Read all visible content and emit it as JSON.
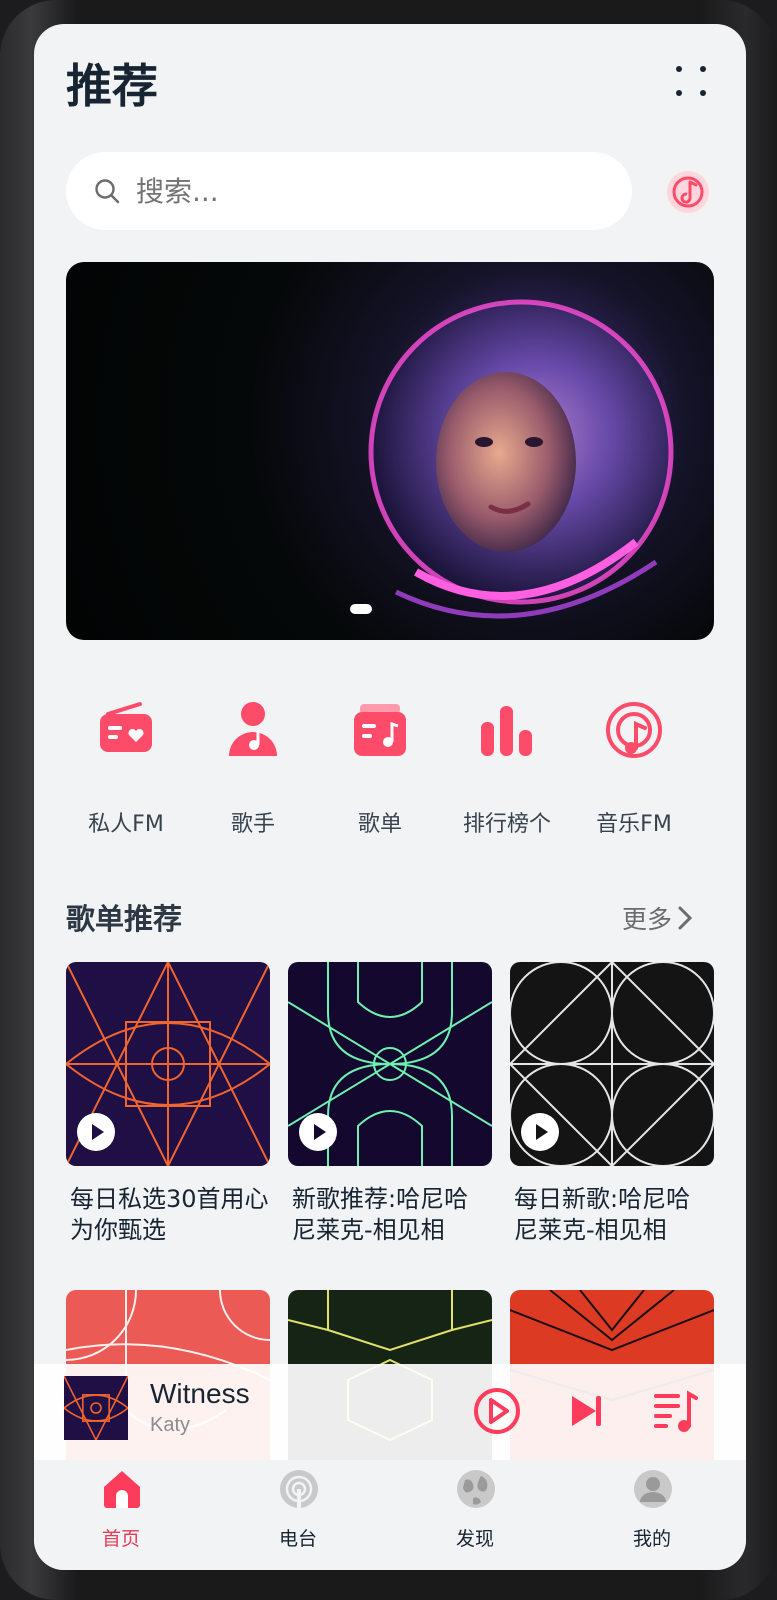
{
  "header": {
    "title": "推荐"
  },
  "search": {
    "placeholder": "搜索..."
  },
  "grid": [
    {
      "label": "私人FM",
      "icon": "radio-icon"
    },
    {
      "label": "歌手",
      "icon": "singer-icon"
    },
    {
      "label": "歌单",
      "icon": "playlist-icon"
    },
    {
      "label": "排行榜个",
      "icon": "ranking-icon"
    },
    {
      "label": "音乐FM",
      "icon": "podcast-icon"
    }
  ],
  "section": {
    "title": "歌单推荐",
    "more": "更多"
  },
  "playlists": [
    {
      "title": "每日私选30首用心为你甄选"
    },
    {
      "title": "新歌推荐:哈尼哈尼莱克-相见相"
    },
    {
      "title": "每日新歌:哈尼哈尼莱克-相见相"
    }
  ],
  "player": {
    "song": "Witness",
    "artist": "Katy"
  },
  "tabs": [
    {
      "label": "首页",
      "active": true
    },
    {
      "label": "电台",
      "active": false
    },
    {
      "label": "发现",
      "active": false
    },
    {
      "label": "我的",
      "active": false
    }
  ],
  "colors": {
    "accent": "#fd4c6a",
    "active_tab": "#e53c55",
    "background": "#f1f3f5"
  }
}
